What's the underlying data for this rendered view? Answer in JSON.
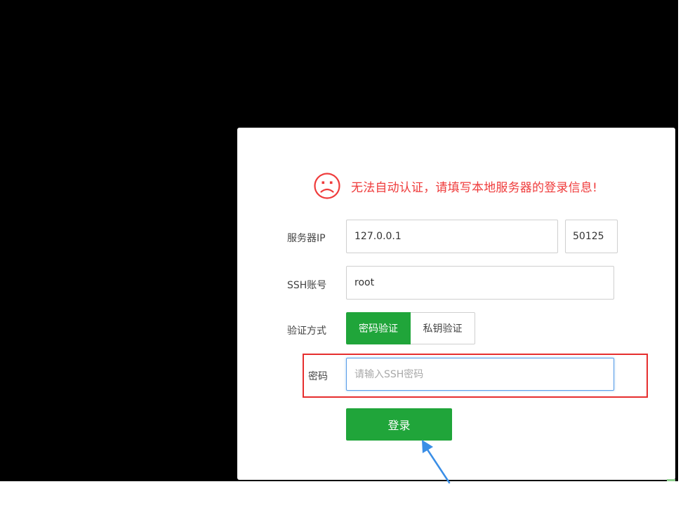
{
  "alert": {
    "icon": "sad-face-icon",
    "message": "无法自动认证，请填写本地服务器的登录信息!",
    "color": "#ef3b3b"
  },
  "form": {
    "server_ip_label": "服务器IP",
    "server_ip_value": "127.0.0.1",
    "port_value": "50125",
    "ssh_account_label": "SSH账号",
    "ssh_account_value": "root",
    "auth_method_label": "验证方式",
    "auth_options": [
      "密码验证",
      "私钥验证"
    ],
    "auth_selected": "密码验证",
    "password_label": "密码",
    "password_placeholder": "请输入SSH密码",
    "password_value": "",
    "login_button": "登录"
  },
  "colors": {
    "accent_green": "#20a53a",
    "highlight_red": "#e62e2e",
    "arrow_blue": "#3a8ee6",
    "focus_blue": "#5a9ee8"
  }
}
